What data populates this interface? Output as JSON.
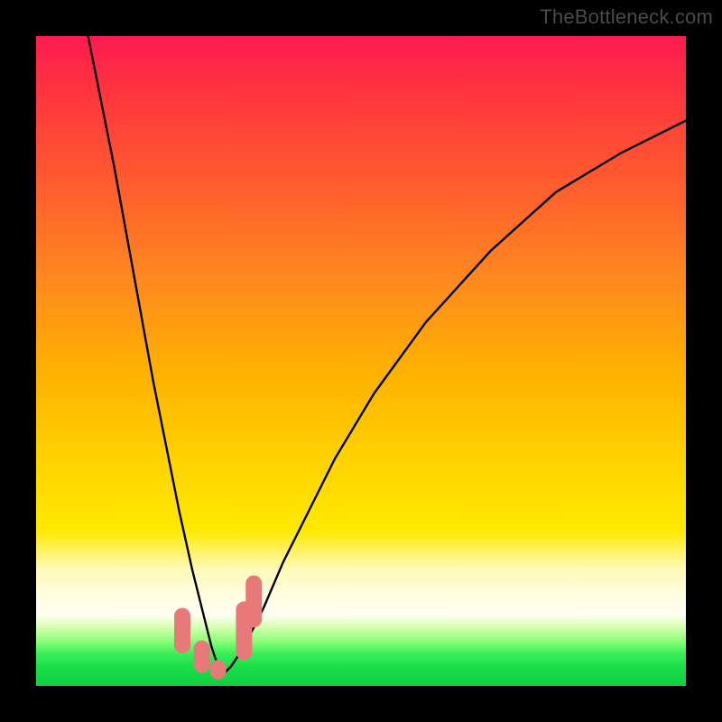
{
  "watermark": "TheBottleneck.com",
  "chart_data": {
    "type": "line",
    "title": "",
    "xlabel": "",
    "ylabel": "",
    "xlim": [
      0,
      100
    ],
    "ylim": [
      0,
      100
    ],
    "series": [
      {
        "name": "bottleneck-curve",
        "x": [
          8,
          10,
          12,
          14,
          16,
          18,
          20,
          22,
          24,
          26,
          27,
          28,
          29,
          30,
          32,
          35,
          38,
          42,
          46,
          52,
          60,
          70,
          80,
          90,
          100
        ],
        "y": [
          100,
          90,
          80,
          69,
          58,
          47,
          37,
          27,
          18,
          10,
          6,
          3,
          2,
          3,
          6,
          12,
          19,
          27,
          35,
          45,
          56,
          67,
          76,
          82,
          87
        ]
      }
    ],
    "markers": [
      {
        "name": "pink-marker",
        "shape": "rounded-rect",
        "x": 22.5,
        "y_top": 12,
        "y_bot": 5,
        "color": "#e77a78"
      },
      {
        "name": "pink-marker",
        "shape": "rounded-rect",
        "x": 25.5,
        "y_top": 7,
        "y_bot": 2,
        "color": "#e77a78"
      },
      {
        "name": "pink-marker",
        "shape": "rounded-rect",
        "x": 28.0,
        "y_top": 4,
        "y_bot": 1,
        "color": "#e77a78"
      },
      {
        "name": "pink-marker",
        "shape": "rounded-rect",
        "x": 32.0,
        "y_top": 13,
        "y_bot": 4,
        "color": "#e77a78"
      },
      {
        "name": "pink-marker",
        "shape": "rounded-rect",
        "x": 33.5,
        "y_top": 17,
        "y_bot": 9,
        "color": "#e77a78"
      }
    ]
  }
}
